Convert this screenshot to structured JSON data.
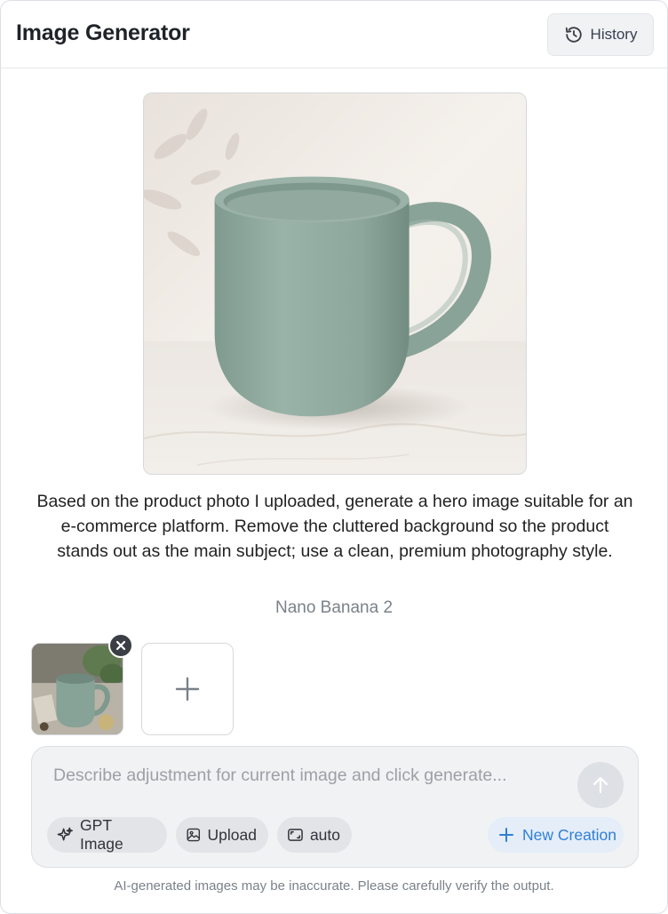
{
  "header": {
    "title": "Image Generator",
    "history_label": "History",
    "history_icon": "history-icon"
  },
  "result": {
    "image_alt": "sage green ceramic mug on marble surface",
    "prompt": "Based on the product photo I uploaded, generate a hero image suitable for an e-commerce platform. Remove the cluttered background so the product stands out as the main subject; use a clean, premium photography style.",
    "model": "Nano Banana 2"
  },
  "attachments": {
    "items": [
      {
        "alt": "uploaded product photo of mug on cluttered table"
      }
    ],
    "remove_icon": "close-icon",
    "add_icon": "plus-icon"
  },
  "composer": {
    "placeholder": "Describe adjustment for current image and click generate...",
    "value": "",
    "send_icon": "arrow-up-icon",
    "chips": {
      "model_label": "GPT Image",
      "model_icon": "sparkles-icon",
      "upload_label": "Upload",
      "upload_icon": "image-icon",
      "ratio_label": "auto",
      "ratio_icon": "aspect-ratio-icon"
    },
    "new_creation_label": "New Creation",
    "new_creation_icon": "plus-icon"
  },
  "footer": {
    "disclaimer": "AI-generated images may be inaccurate. Please carefully verify the output."
  },
  "colors": {
    "accent": "#2f7fd6",
    "accent_bg": "#e4edf8",
    "mug": "#8fa89e",
    "panel": "#f1f2f4"
  }
}
